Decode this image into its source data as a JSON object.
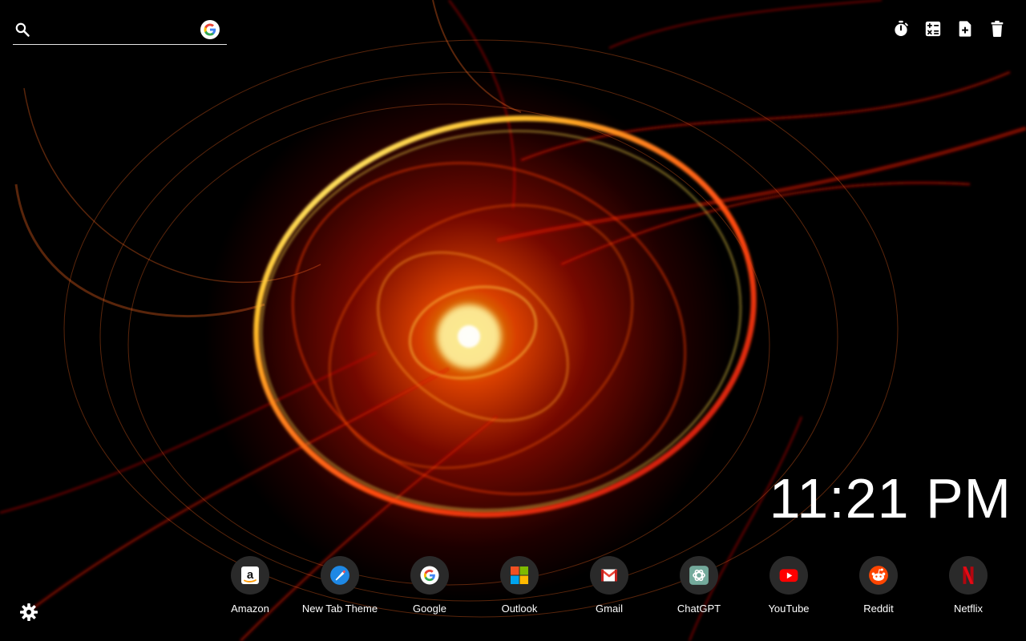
{
  "search": {
    "placeholder": "",
    "engine_icon": "google-g-icon"
  },
  "toolbar": {
    "items": [
      {
        "icon": "stopwatch-icon"
      },
      {
        "icon": "calculator-icon"
      },
      {
        "icon": "add-note-icon"
      },
      {
        "icon": "trash-icon"
      }
    ]
  },
  "clock": {
    "time": "11:21 PM"
  },
  "shortcuts": [
    {
      "label": "Amazon",
      "icon": "amazon-icon"
    },
    {
      "label": "New Tab Theme",
      "icon": "new-tab-theme-icon"
    },
    {
      "label": "Google",
      "icon": "google-icon"
    },
    {
      "label": "Outlook",
      "icon": "outlook-icon"
    },
    {
      "label": "Gmail",
      "icon": "gmail-icon"
    },
    {
      "label": "ChatGPT",
      "icon": "chatgpt-icon"
    },
    {
      "label": "YouTube",
      "icon": "youtube-icon"
    },
    {
      "label": "Reddit",
      "icon": "reddit-icon"
    },
    {
      "label": "Netflix",
      "icon": "netflix-icon"
    }
  ],
  "settings": {
    "icon": "gear-icon"
  },
  "colors": {
    "accent": "#ff2a00",
    "glow": "#ffd94a",
    "background": "#000000"
  }
}
